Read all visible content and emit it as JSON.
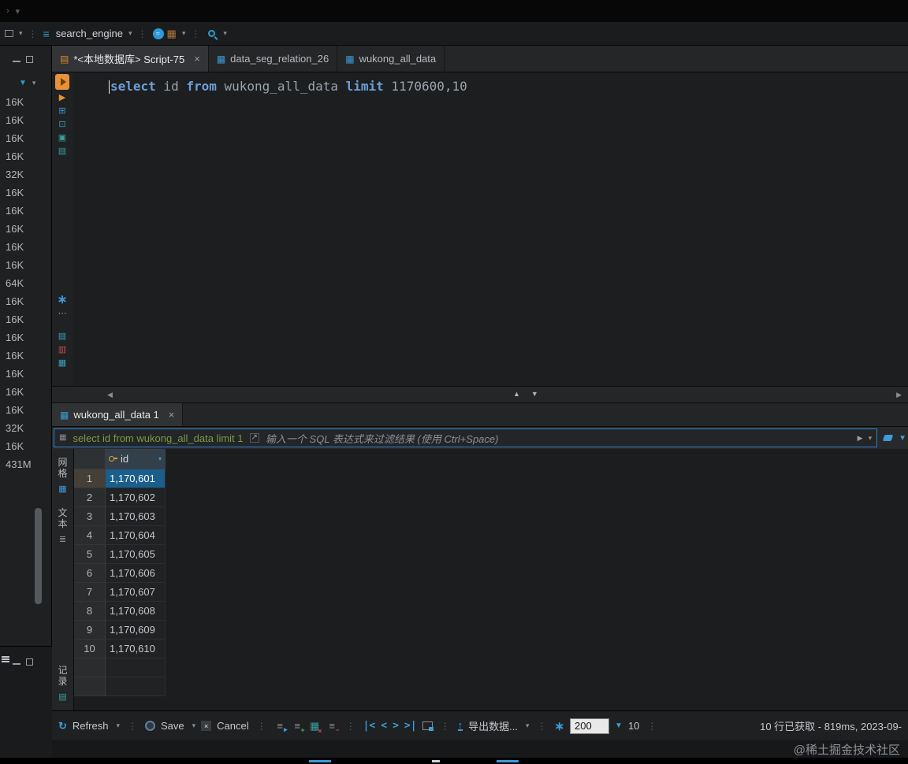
{
  "toolbar": {
    "connection": "search_engine"
  },
  "editor_tabs": [
    {
      "label": "*<本地数据库> Script-75"
    },
    {
      "label": "data_seg_relation_26"
    },
    {
      "label": "wukong_all_data"
    }
  ],
  "sql_tokens": [
    {
      "text": "select",
      "kw": true
    },
    {
      "text": " id ",
      "kw": false
    },
    {
      "text": "from",
      "kw": true
    },
    {
      "text": " wukong_all_data ",
      "kw": false
    },
    {
      "text": "limit",
      "kw": true
    },
    {
      "text": " 1170600,10",
      "kw": false
    }
  ],
  "sidebar": {
    "sizes": [
      "16K",
      "16K",
      "16K",
      "16K",
      "32K",
      "16K",
      "16K",
      "16K",
      "16K",
      "16K",
      "64K",
      "16K",
      "16K",
      "16K",
      "16K",
      "16K",
      "16K",
      "16K",
      "32K",
      "16K",
      "431M"
    ]
  },
  "results": {
    "tab_label": "wukong_all_data 1",
    "filter_query": "select id from wukong_all_data limit 1",
    "filter_placeholder": "输入一个 SQL 表达式来过滤结果 (使用 Ctrl+Space)",
    "column_header": "id",
    "selected_row_index": 0,
    "rows": [
      {
        "num": "1",
        "id": "1,170,601"
      },
      {
        "num": "2",
        "id": "1,170,602"
      },
      {
        "num": "3",
        "id": "1,170,603"
      },
      {
        "num": "4",
        "id": "1,170,604"
      },
      {
        "num": "5",
        "id": "1,170,605"
      },
      {
        "num": "6",
        "id": "1,170,606"
      },
      {
        "num": "7",
        "id": "1,170,607"
      },
      {
        "num": "8",
        "id": "1,170,608"
      },
      {
        "num": "9",
        "id": "1,170,609"
      },
      {
        "num": "10",
        "id": "1,170,610"
      }
    ],
    "side_tabs": {
      "grid": "网格",
      "text": "文本",
      "record": "记录"
    }
  },
  "bottom_toolbar": {
    "refresh": "Refresh",
    "save": "Save",
    "cancel": "Cancel",
    "export": "导出数据...",
    "fetch_size": "200",
    "segment": "10",
    "status": "10 行已获取 - 819ms, 2023-09-"
  },
  "watermark": "@稀土掘金技术社区",
  "colors": {
    "accent": "#3d9bd8",
    "selection": "#1a5e8c",
    "keyword": "#6e9fd6",
    "filter_text_green": "#7c9a45",
    "run_orange": "#e8903a"
  }
}
